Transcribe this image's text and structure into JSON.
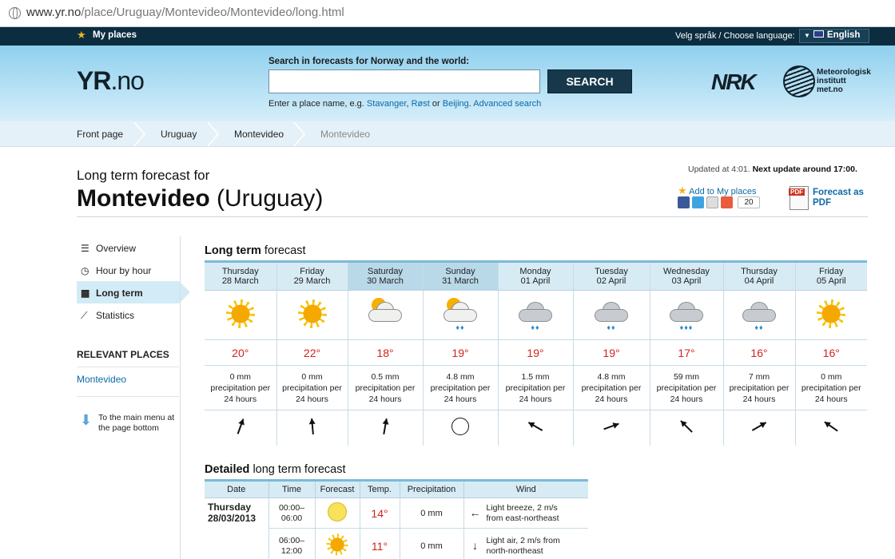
{
  "browser": {
    "url_main": "www.yr.no",
    "url_path": "/place/Uruguay/Montevideo/Montevideo/long.html"
  },
  "topbar": {
    "my_places": "My places",
    "language_label": "Velg språk / Choose language:",
    "language_value": "English"
  },
  "header": {
    "logo": "YR",
    "logo_suffix": ".no",
    "search_label": "Search in forecasts for Norway and the world:",
    "search_value": "",
    "search_button": "SEARCH",
    "hint_prefix": "Enter a place name, e.g.",
    "hint_ex1": "Stavanger",
    "hint_ex2": "Røst",
    "hint_or": "or",
    "hint_ex3": "Beijing",
    "advanced": "Advanced search",
    "nrk": "NRK",
    "met_line1": "Meteorologisk",
    "met_line2": "institutt",
    "met_line3": "met.no"
  },
  "breadcrumb": [
    "Front page",
    "Uruguay",
    "Montevideo",
    "Montevideo"
  ],
  "title": {
    "pre": "Long term forecast for",
    "place": "Montevideo",
    "country": "(Uruguay)"
  },
  "updated": {
    "text": "Updated at 4:01.",
    "next": "Next update around 17:00."
  },
  "actions": {
    "add_my_places": "Add to My places",
    "share_count": "20",
    "pdf_line1": "Forecast as",
    "pdf_line2": "PDF"
  },
  "sidebar": {
    "items": [
      {
        "label": "Overview",
        "icon": "list-icon"
      },
      {
        "label": "Hour by hour",
        "icon": "clock-icon"
      },
      {
        "label": "Long term",
        "icon": "calendar-icon"
      },
      {
        "label": "Statistics",
        "icon": "chart-icon"
      }
    ],
    "relevant_heading": "RELEVANT PLACES",
    "relevant_link": "Montevideo",
    "to_main_line1": "To the main menu at",
    "to_main_line2": "the page bottom"
  },
  "longterm": {
    "heading_bold": "Long term",
    "heading_rest": "forecast",
    "days": [
      {
        "day": "Thursday",
        "date": "28 March",
        "icon": "sun",
        "temp": "20°",
        "precip": "0 mm",
        "wind_dir": 200
      },
      {
        "day": "Friday",
        "date": "29 March",
        "icon": "sun",
        "temp": "22°",
        "precip": "0 mm",
        "wind_dir": 175
      },
      {
        "day": "Saturday",
        "date": "30 March",
        "icon": "partly-cloudy",
        "temp": "18°",
        "precip": "0.5 mm",
        "wind_dir": 190
      },
      {
        "day": "Sunday",
        "date": "31 March",
        "icon": "sun-rain",
        "temp": "19°",
        "precip": "4.8 mm",
        "wind_dir": null
      },
      {
        "day": "Monday",
        "date": "01 April",
        "icon": "rain",
        "temp": "19°",
        "precip": "1.5 mm",
        "wind_dir": 120
      },
      {
        "day": "Tuesday",
        "date": "02 April",
        "icon": "rain",
        "temp": "19°",
        "precip": "4.8 mm",
        "wind_dir": 250
      },
      {
        "day": "Wednesday",
        "date": "03 April",
        "icon": "heavy-rain",
        "temp": "17°",
        "precip": "59 mm",
        "wind_dir": 135
      },
      {
        "day": "Thursday",
        "date": "04 April",
        "icon": "rain",
        "temp": "16°",
        "precip": "7 mm",
        "wind_dir": 240
      },
      {
        "day": "Friday",
        "date": "05 April",
        "icon": "sun",
        "temp": "16°",
        "precip": "0 mm",
        "wind_dir": 125
      }
    ],
    "precip_line2": "precipitation per",
    "precip_line3": "24 hours"
  },
  "detailed": {
    "heading_bold": "Detailed",
    "heading_rest": "long term forecast",
    "columns": [
      "Date",
      "Time",
      "Forecast",
      "Temp.",
      "Precipitation",
      "Wind"
    ],
    "date_day": "Thursday",
    "date_date": "28/03/2013",
    "rows": [
      {
        "time1": "00:00–",
        "time2": "06:00",
        "icon": "pale-sun",
        "temp": "14°",
        "precip": "0 mm",
        "wind1": "Light breeze, 2 m/s",
        "wind2": "from east-northeast",
        "wind_icon": "←"
      },
      {
        "time1": "06:00–",
        "time2": "12:00",
        "icon": "sun",
        "temp": "11°",
        "precip": "0 mm",
        "wind1": "Light air, 2 m/s from",
        "wind2": "north-northeast",
        "wind_icon": "↓"
      }
    ]
  }
}
